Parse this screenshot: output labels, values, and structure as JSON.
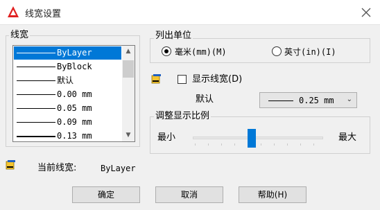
{
  "window": {
    "title": "线宽设置",
    "icon": "autocad-logo-icon",
    "close_icon": "close-icon"
  },
  "lineweights": {
    "label": "线宽",
    "items": [
      {
        "label": "ByLayer",
        "selected": true
      },
      {
        "label": "ByBlock",
        "selected": false
      },
      {
        "label": "默认",
        "selected": false
      },
      {
        "label": "0.00 mm",
        "selected": false
      },
      {
        "label": "0.05 mm",
        "selected": false
      },
      {
        "label": "0.09 mm",
        "selected": false
      },
      {
        "label": "0.13 mm",
        "selected": false
      }
    ]
  },
  "units": {
    "label": "列出单位",
    "options": [
      {
        "label": "毫米(mm)(M)",
        "checked": true
      },
      {
        "label": "英寸(in)(I)",
        "checked": false
      }
    ]
  },
  "display": {
    "checkbox_label": "显示线宽(D)",
    "checked": false,
    "icon": "lineweight-icon"
  },
  "default": {
    "label": "默认",
    "value": "0.25 mm"
  },
  "scale": {
    "label": "调整显示比例",
    "min_label": "最小",
    "max_label": "最大",
    "value_fraction": 0.45
  },
  "current": {
    "label": "当前线宽:",
    "value": "ByLayer",
    "icon": "lineweight-icon"
  },
  "buttons": {
    "ok": "确定",
    "cancel": "取消",
    "help": "帮助(H)"
  },
  "colors": {
    "accent": "#0078d7",
    "background": "#f0f0f0"
  }
}
